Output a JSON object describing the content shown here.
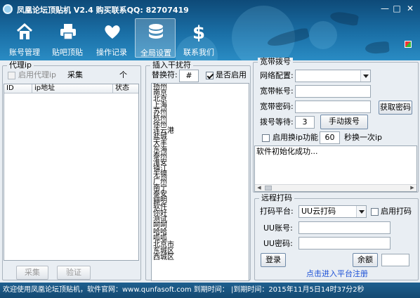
{
  "window": {
    "title": "凤凰论坛顶贴机 V2.4 购买联系QQ: 82707419"
  },
  "toolbar": [
    {
      "label": "账号管理",
      "icon": "home-icon"
    },
    {
      "label": "贴吧顶贴",
      "icon": "printer-icon"
    },
    {
      "label": "操作记录",
      "icon": "heart-icon"
    },
    {
      "label": "全局设置",
      "icon": "database-icon",
      "active": true
    },
    {
      "label": "联系我们",
      "icon": "dollar-icon"
    }
  ],
  "proxy": {
    "title": "代理ip",
    "enable_label": "启用代理ip",
    "collect_text": "采集",
    "count_unit": "个",
    "columns": [
      "ID",
      "ip地址",
      "状态"
    ],
    "collect_button": "采集",
    "verify_button": "验证"
  },
  "insert": {
    "title": "插入干扰符",
    "replace_label": "替换符:",
    "replace_value": "#",
    "enable_label": "是否启用",
    "cities": [
      "扬州",
      "南京",
      "北京",
      "上海",
      "苏州",
      "杭州",
      "徐州",
      "连云港",
      "盐城",
      "大丰",
      "东海",
      "泰州",
      "淮安",
      "镇江",
      "无锡",
      "广州",
      "南宁",
      "泰安",
      "錨明",
      "软件",
      "你好",
      "测试",
      "呵呵",
      "哈哈",
      "呱呱",
      "北京市",
      "东城区",
      "西城区"
    ]
  },
  "dialup": {
    "title": "宽带拨号",
    "network_label": "网络配置:",
    "network_value": "",
    "account_label": "宽带帐号:",
    "account_value": "",
    "password_label": "宽带密码:",
    "password_value": "",
    "get_password_button": "获取密码",
    "wait_label": "拨号等待:",
    "wait_value": "3",
    "manual_dial_button": "手动拨号",
    "switch_ip_label": "启用换ip功能",
    "switch_ip_value": "60",
    "switch_ip_suffix": "秒换一次ip",
    "log_text": "软件初始化成功..."
  },
  "remote": {
    "title": "远程打码",
    "platform_label": "打码平台:",
    "platform_value": "UU云打码",
    "enable_label": "启用打码",
    "account_label": "UU账号:",
    "account_value": "",
    "password_label": "UU密码:",
    "password_value": "",
    "login_button": "登录",
    "balance_button": "余额",
    "balance_value": "",
    "register_link": "点击进入平台注册"
  },
  "status": {
    "text": "欢迎使用凤凰论坛顶贴机，软件官网：www.qunfasoft.com 到期时间：  |到期时间：2015年11月5日14时37分2秒"
  }
}
